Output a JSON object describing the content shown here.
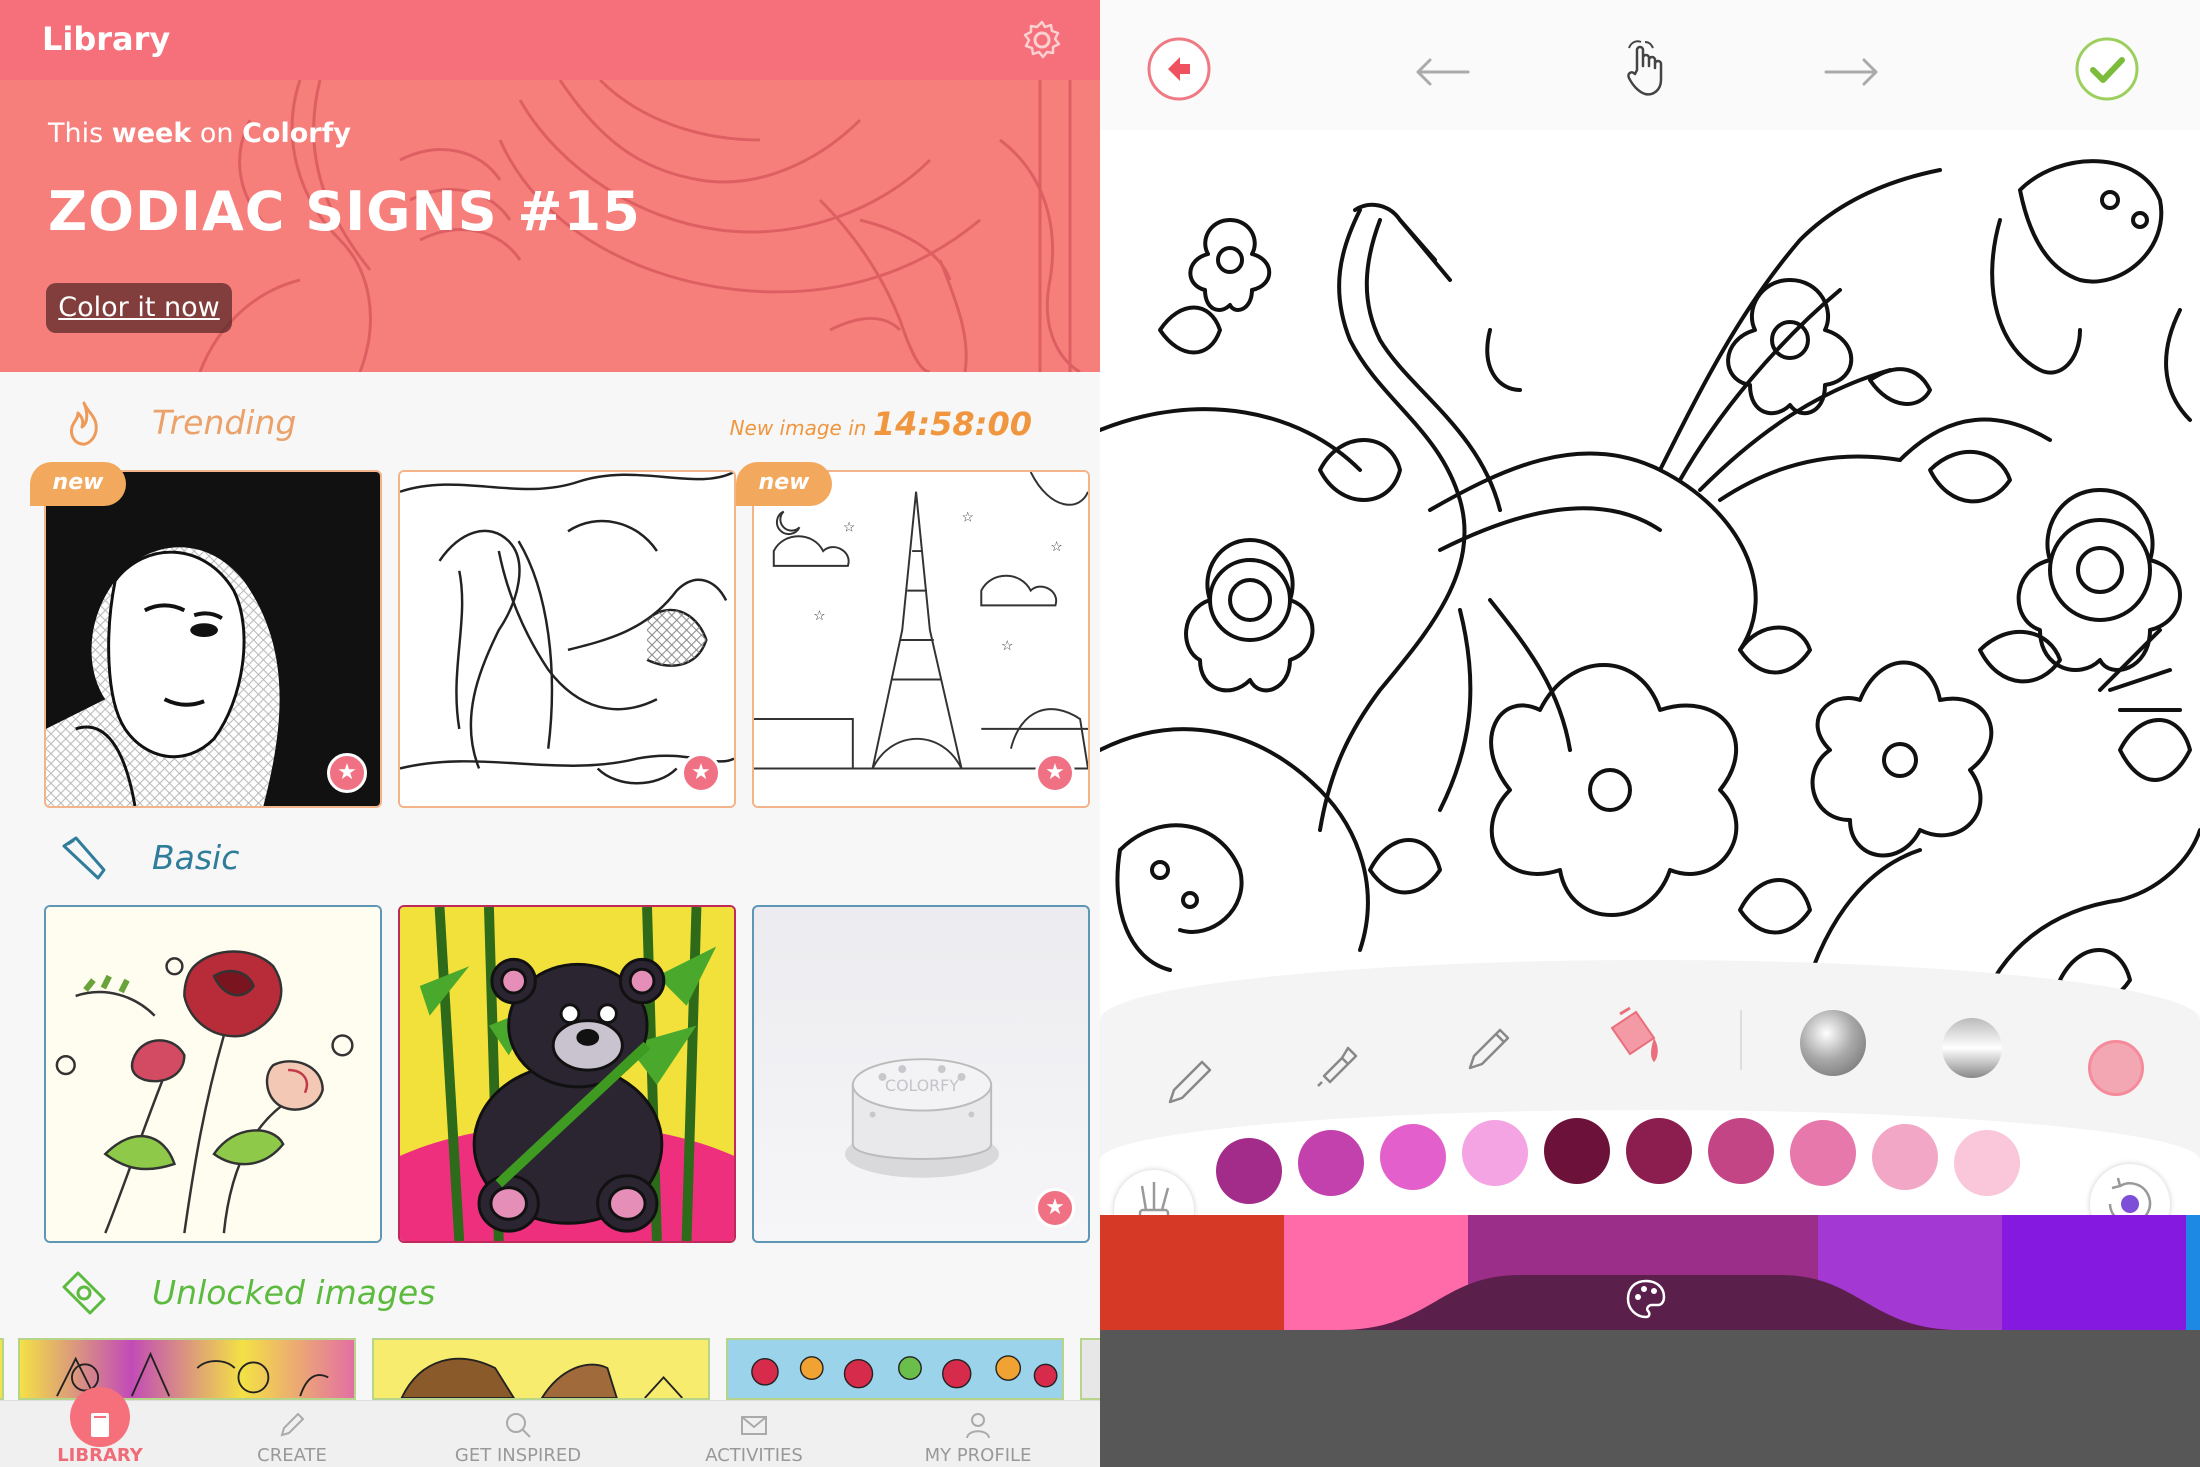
{
  "left": {
    "header": {
      "title": "Library",
      "settings_icon": "gear-icon"
    },
    "hero": {
      "subtitle_prefix": "This ",
      "subtitle_bold1": "week",
      "subtitle_mid": " on ",
      "subtitle_bold2": "Colorfy",
      "title": "ZODIAC SIGNS #15",
      "cta": "Color it now"
    },
    "trending": {
      "label": "Trending",
      "countdown_prefix": "New image in ",
      "countdown_value": "14:58:00",
      "badge": "new",
      "color": "#e79a5d"
    },
    "basic": {
      "label": "Basic",
      "color": "#2f7d9b"
    },
    "unlocked": {
      "label": "Unlocked images",
      "color": "#5cbb3f"
    },
    "tabs": [
      {
        "label": "LIBRARY",
        "icon": "book-icon"
      },
      {
        "label": "CREATE",
        "icon": "pencil-icon"
      },
      {
        "label": "GET INSPIRED",
        "icon": "search-icon"
      },
      {
        "label": "ACTIVITIES",
        "icon": "envelope-icon"
      },
      {
        "label": "MY PROFILE",
        "icon": "person-icon"
      }
    ],
    "active_tab": "LIBRARY"
  },
  "right": {
    "toolbar": {
      "back_icon": "back-arrow-icon",
      "undo_icon": "undo-icon",
      "hand_icon": "hand-pointer-icon",
      "redo_icon": "redo-icon",
      "done_icon": "checkmark-icon"
    },
    "tools": [
      "pencil-icon",
      "marker-icon",
      "pen-icon",
      "paint-bucket-icon"
    ],
    "textures": [
      "silver-sphere-icon",
      "metallic-sphere-icon",
      "pink-swatch-icon"
    ],
    "colors": [
      "#a32c8a",
      "#c341ac",
      "#e360cc",
      "#f4a4e2",
      "#6c1139",
      "#8b1d4f",
      "#c44585",
      "#e778ab",
      "#f3a7c7",
      "#f9c6da"
    ],
    "palette_bar": [
      "#d63a26",
      "#ff6aa8",
      "#9b2e88",
      "#a339d2",
      "#8619e0"
    ],
    "palette_icon": "palette-icon",
    "brush_cup_icon": "brushes-icon",
    "reset_icon": "reset-color-icon"
  }
}
